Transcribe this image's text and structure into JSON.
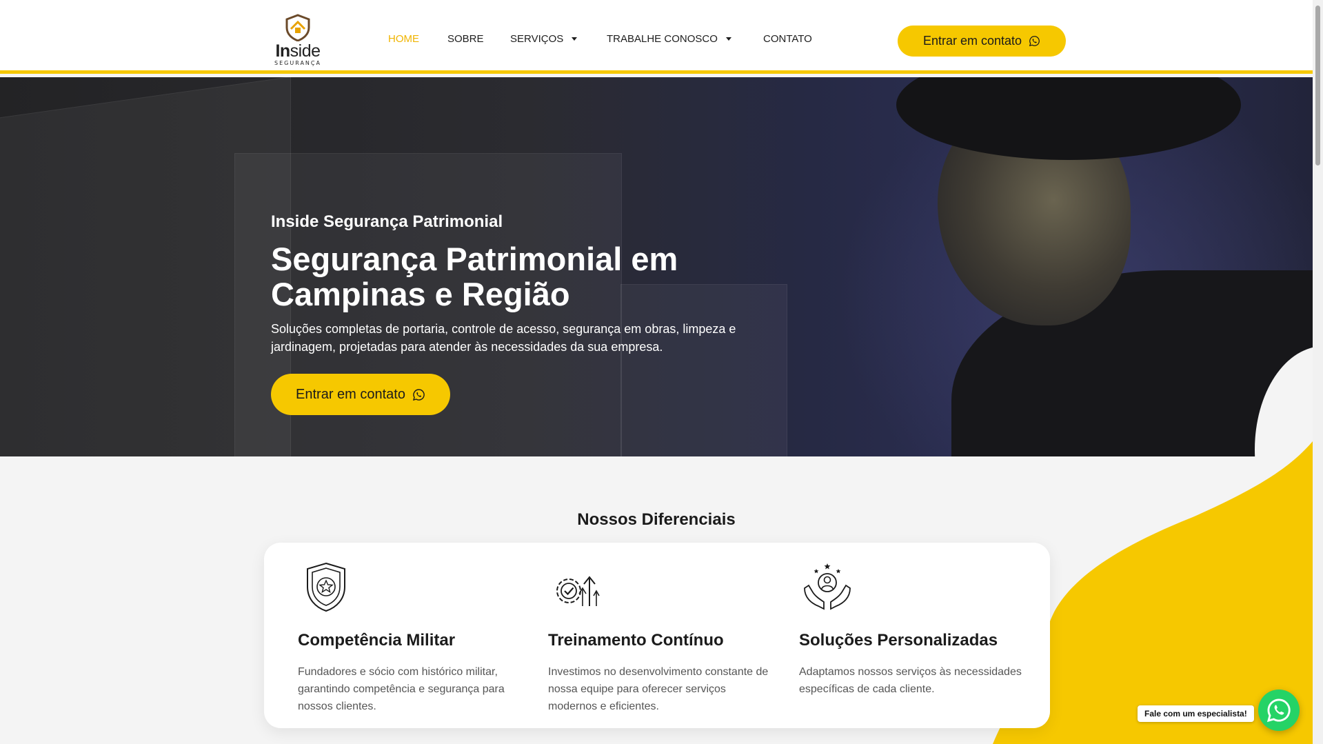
{
  "header": {
    "logo": {
      "word_bold": "In",
      "word_rest": "side",
      "tagline": "SEGURANÇA"
    },
    "nav": [
      {
        "label": "HOME",
        "active": true,
        "dropdown": false
      },
      {
        "label": "SOBRE",
        "active": false,
        "dropdown": false
      },
      {
        "label": "SERVIÇOS",
        "active": false,
        "dropdown": true
      },
      {
        "label": "TRABALHE CONOSCO",
        "active": false,
        "dropdown": true
      },
      {
        "label": "CONTATO",
        "active": false,
        "dropdown": false
      }
    ],
    "cta_label": "Entrar em contato",
    "cta_icon": "whatsapp-icon"
  },
  "hero": {
    "kicker": "Inside Segurança Patrimonial",
    "title": "Segurança Patrimonial em Campinas e Região",
    "description": "Soluções completas de portaria, controle de acesso, segurança em obras, limpeza e jardinagem, projetadas para atender às necessidades da sua empresa.",
    "cta_label": "Entrar em contato",
    "cta_icon": "whatsapp-icon"
  },
  "features": {
    "title": "Nossos Diferenciais",
    "items": [
      {
        "icon": "police-badge-icon",
        "title": "Competência Militar",
        "description": "Fundadores e sócio com histórico militar, garantindo competência e segurança para nossos clientes."
      },
      {
        "icon": "gear-growth-icon",
        "title": "Treinamento Contínuo",
        "description": "Investimos no desenvolvimento constante de nossa equipe para oferecer serviços modernos e eficientes."
      },
      {
        "icon": "hands-person-icon",
        "title": "Soluções Personalizadas",
        "description": "Adaptamos nossos serviços às necessidades específicas de cada cliente."
      }
    ]
  },
  "whatsapp_float": {
    "label": "Fale com um especialista!",
    "icon": "whatsapp-icon"
  },
  "colors": {
    "accent": "#f6c800",
    "nav_active": "#f0b400",
    "text_dark": "#1b1b1b",
    "whatsapp": "#25d366"
  }
}
